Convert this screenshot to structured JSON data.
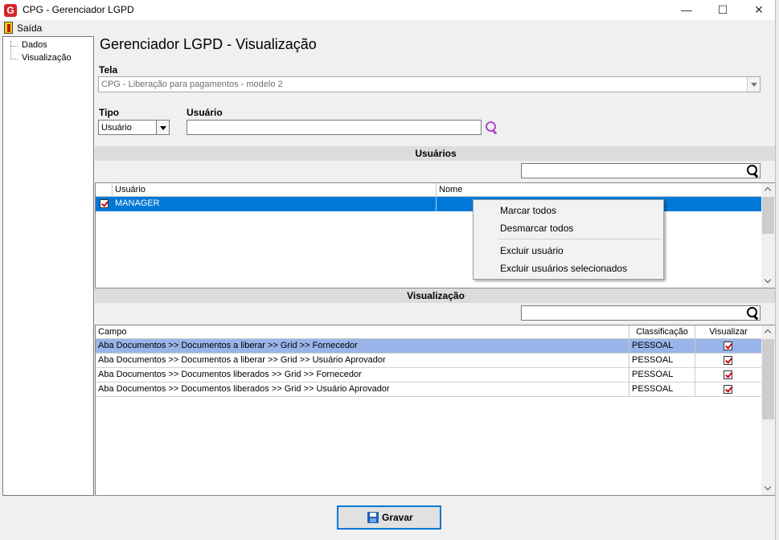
{
  "window": {
    "title": "CPG - Gerenciador LGPD",
    "app_icon_letter": "G"
  },
  "menu": {
    "exit_label": "Saída"
  },
  "tree": {
    "items": [
      "Dados",
      "Visualização"
    ]
  },
  "page": {
    "title": "Gerenciador LGPD - Visualização"
  },
  "tela": {
    "label": "Tela",
    "value": "CPG - Liberação para pagamentos - modelo 2"
  },
  "tipo": {
    "label": "Tipo",
    "value": "Usuário"
  },
  "usuario": {
    "label": "Usuário",
    "value": ""
  },
  "usuarios_section": {
    "title": "Usuários",
    "columns": [
      "Usuário",
      "Nome"
    ],
    "rows": [
      {
        "checked": true,
        "usuario": "MANAGER",
        "nome": ""
      }
    ]
  },
  "context_menu": {
    "items": [
      "Marcar todos",
      "Desmarcar todos",
      "Excluir usuário",
      "Excluir usuários selecionados"
    ]
  },
  "visualizacao_section": {
    "title": "Visualização",
    "columns": [
      "Campo",
      "Classificação",
      "Visualizar"
    ],
    "rows": [
      {
        "campo": "Aba Documentos >> Documentos a liberar >> Grid >> Fornecedor",
        "classificacao": "PESSOAL",
        "visualizar": true
      },
      {
        "campo": "Aba Documentos >> Documentos a liberar >> Grid >> Usuário Aprovador",
        "classificacao": "PESSOAL",
        "visualizar": true
      },
      {
        "campo": "Aba Documentos >> Documentos liberados >> Grid >> Fornecedor",
        "classificacao": "PESSOAL",
        "visualizar": true
      },
      {
        "campo": "Aba Documentos >> Documentos liberados >> Grid >> Usuário Aprovador",
        "classificacao": "PESSOAL",
        "visualizar": true
      }
    ]
  },
  "buttons": {
    "save_label": "Gravar"
  },
  "colors": {
    "selected_row": "#0078d7",
    "selected_row_light": "#99b4e8",
    "search_icon_purple": "#b149c8",
    "checkbox_red": "#d0021b"
  }
}
